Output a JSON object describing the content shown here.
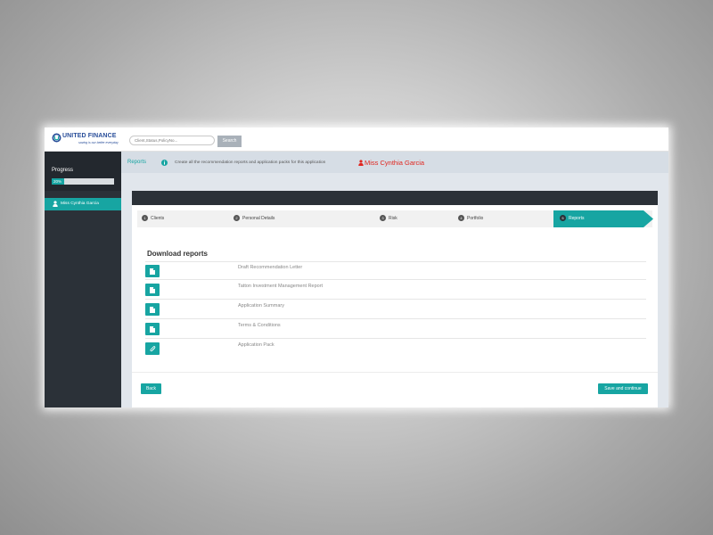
{
  "brand": {
    "name": "UNITED FINANCE",
    "tagline": "saving is our better everyday",
    "accent_color": "#17a5a2",
    "dark_color": "#2b3138",
    "highlight_color": "#e0261f"
  },
  "topbar": {
    "search_placeholder": "Client,Status,PolicyNo...",
    "search_value": "",
    "search_button": "Search"
  },
  "sidebar": {
    "progress_label": "Progress",
    "progress_percent": 20,
    "progress_text": "20%",
    "client_name": "Miss Cynthia Garcia",
    "client_icon": "user-icon"
  },
  "header": {
    "breadcrumb": "Reports",
    "info_icon": "info-icon",
    "info_text": "Create all the recommendation reports and application packs for this application",
    "client_title": "Miss Cynthia Garcia"
  },
  "steps": [
    {
      "number": "1",
      "label": "Clients",
      "active": false
    },
    {
      "number": "2",
      "label": "Personal Details",
      "active": false
    },
    {
      "number": "3",
      "label": "Risk",
      "active": false
    },
    {
      "number": "4",
      "label": "Portfolio",
      "active": false
    },
    {
      "number": "5",
      "label": "Reports",
      "active": true
    }
  ],
  "reports": {
    "title": "Download reports",
    "items": [
      {
        "label": "Draft Recommendation Letter",
        "icon": "document-icon"
      },
      {
        "label": "Tatton Investment Management Report",
        "icon": "document-icon"
      },
      {
        "label": "Application Summary",
        "icon": "document-icon"
      },
      {
        "label": "Terms & Conditions",
        "icon": "document-icon"
      },
      {
        "label": "Application Pack",
        "icon": "paperclip-icon"
      }
    ]
  },
  "footer": {
    "back_label": "Back",
    "save_label": "Save and continue"
  }
}
